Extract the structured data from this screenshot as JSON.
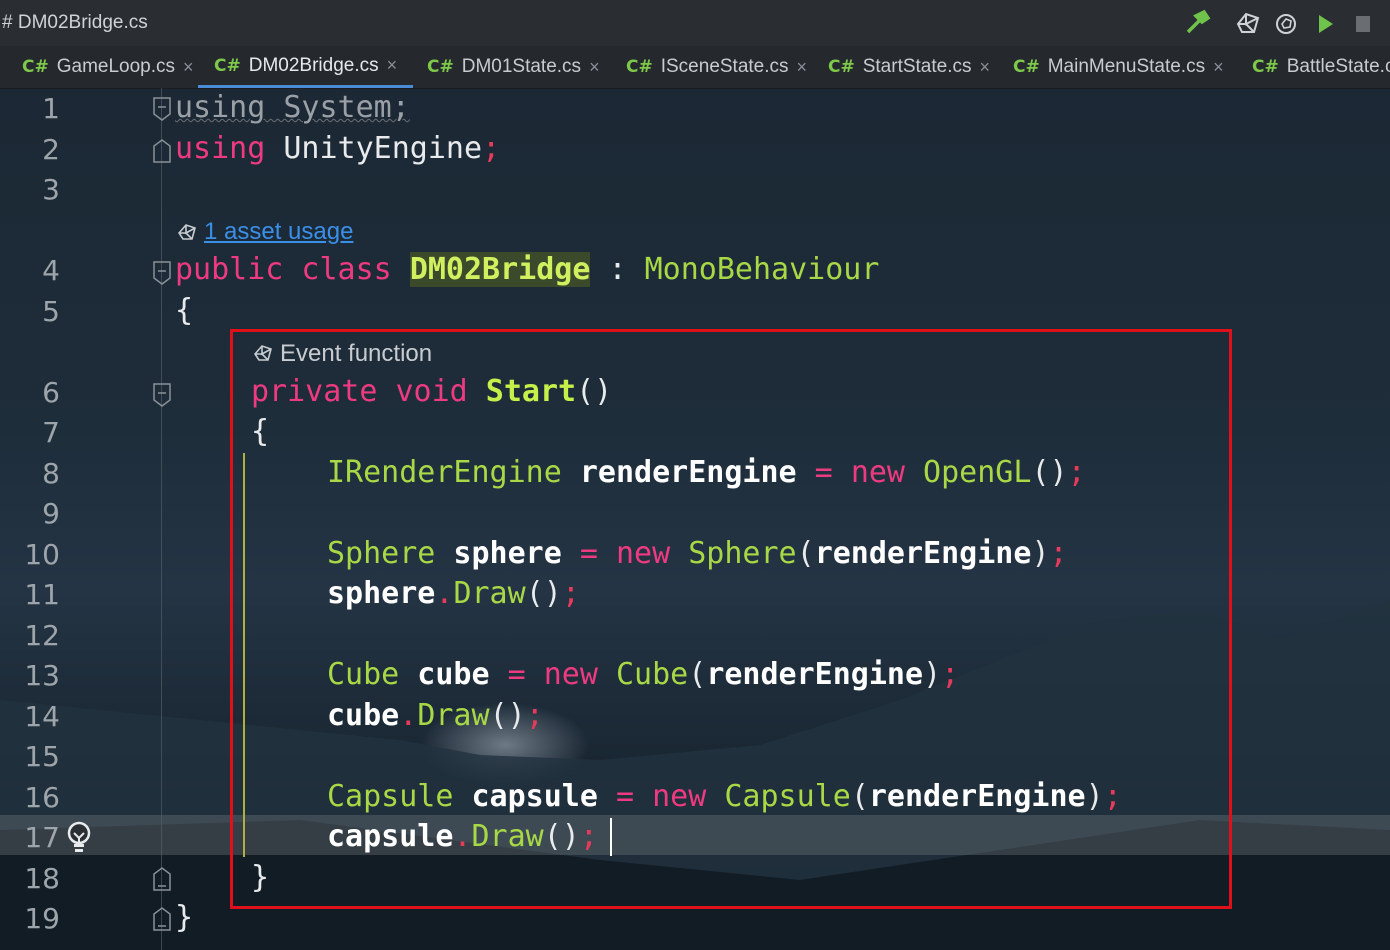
{
  "window": {
    "title": "# DM02Bridge.cs"
  },
  "tabs": [
    {
      "lang": "C#",
      "label": "GameLoop.cs",
      "close": "×"
    },
    {
      "lang": "C#",
      "label": "DM02Bridge.cs",
      "close": "×",
      "active": true
    },
    {
      "lang": "C#",
      "label": "DM01State.cs",
      "close": "×"
    },
    {
      "lang": "C#",
      "label": "ISceneState.cs",
      "close": "×"
    },
    {
      "lang": "C#",
      "label": "StartState.cs",
      "close": "×"
    },
    {
      "lang": "C#",
      "label": "MainMenuState.cs",
      "close": "×"
    },
    {
      "lang": "C#",
      "label": "BattleState.cs",
      "close": ""
    }
  ],
  "toolbar": {
    "icons": [
      "hammer-icon",
      "unity-icon",
      "unity-refresh-icon",
      "play-icon",
      "stop-icon"
    ]
  },
  "gutter": [
    "1",
    "2",
    "3",
    "4",
    "5",
    "6",
    "7",
    "8",
    "9",
    "10",
    "11",
    "12",
    "13",
    "14",
    "15",
    "16",
    "17",
    "18",
    "19"
  ],
  "hints": {
    "asset_usage": "1 asset usage",
    "event_function": "Event function"
  },
  "code": {
    "l1": {
      "kw": "using",
      "rest": " System;"
    },
    "l2": {
      "kw": "using",
      "name": " UnityEngine",
      "semi": ";"
    },
    "l4": {
      "kw1": "public",
      "kw2": " class",
      "cls": "DM02Bridge",
      "colon": " : ",
      "base": "MonoBehaviour"
    },
    "l5": {
      "brace": "{"
    },
    "l6": {
      "kw1": "private",
      "kw2": " void",
      "fn": " Start",
      "parens": "()"
    },
    "l7": {
      "brace": "{"
    },
    "l8": {
      "type": "IRenderEngine",
      "var": " renderEngine",
      "eq": " = ",
      "kw": "new",
      "ctor": " OpenGL",
      "parens": "()",
      "semi": ";"
    },
    "l10": {
      "type": "Sphere",
      "var": " sphere",
      "eq": " = ",
      "kw": "new",
      "ctor": " Sphere",
      "open": "(",
      "arg": "renderEngine",
      "close": ")",
      "semi": ";"
    },
    "l11": {
      "obj": "sphere",
      "dot": ".",
      "method": "Draw",
      "parens": "()",
      "semi": ";"
    },
    "l13": {
      "type": "Cube",
      "var": " cube",
      "eq": " = ",
      "kw": "new",
      "ctor": " Cube",
      "open": "(",
      "arg": "renderEngine",
      "close": ")",
      "semi": ";"
    },
    "l14": {
      "obj": "cube",
      "dot": ".",
      "method": "Draw",
      "parens": "()",
      "semi": ";"
    },
    "l16": {
      "type": "Capsule",
      "var": " capsule",
      "eq": " = ",
      "kw": "new",
      "ctor": " Capsule",
      "open": "(",
      "arg": "renderEngine",
      "close": ")",
      "semi": ";"
    },
    "l17": {
      "obj": "capsule",
      "dot": ".",
      "method": "Draw",
      "parens": "()",
      "semi": ";"
    },
    "l18": {
      "brace": "}"
    },
    "l19": {
      "brace": "}"
    }
  },
  "colors": {
    "keyword": "#ee3a80",
    "type": "#a8d846",
    "highlight": "#e0101a",
    "link": "#3a8fe8"
  }
}
